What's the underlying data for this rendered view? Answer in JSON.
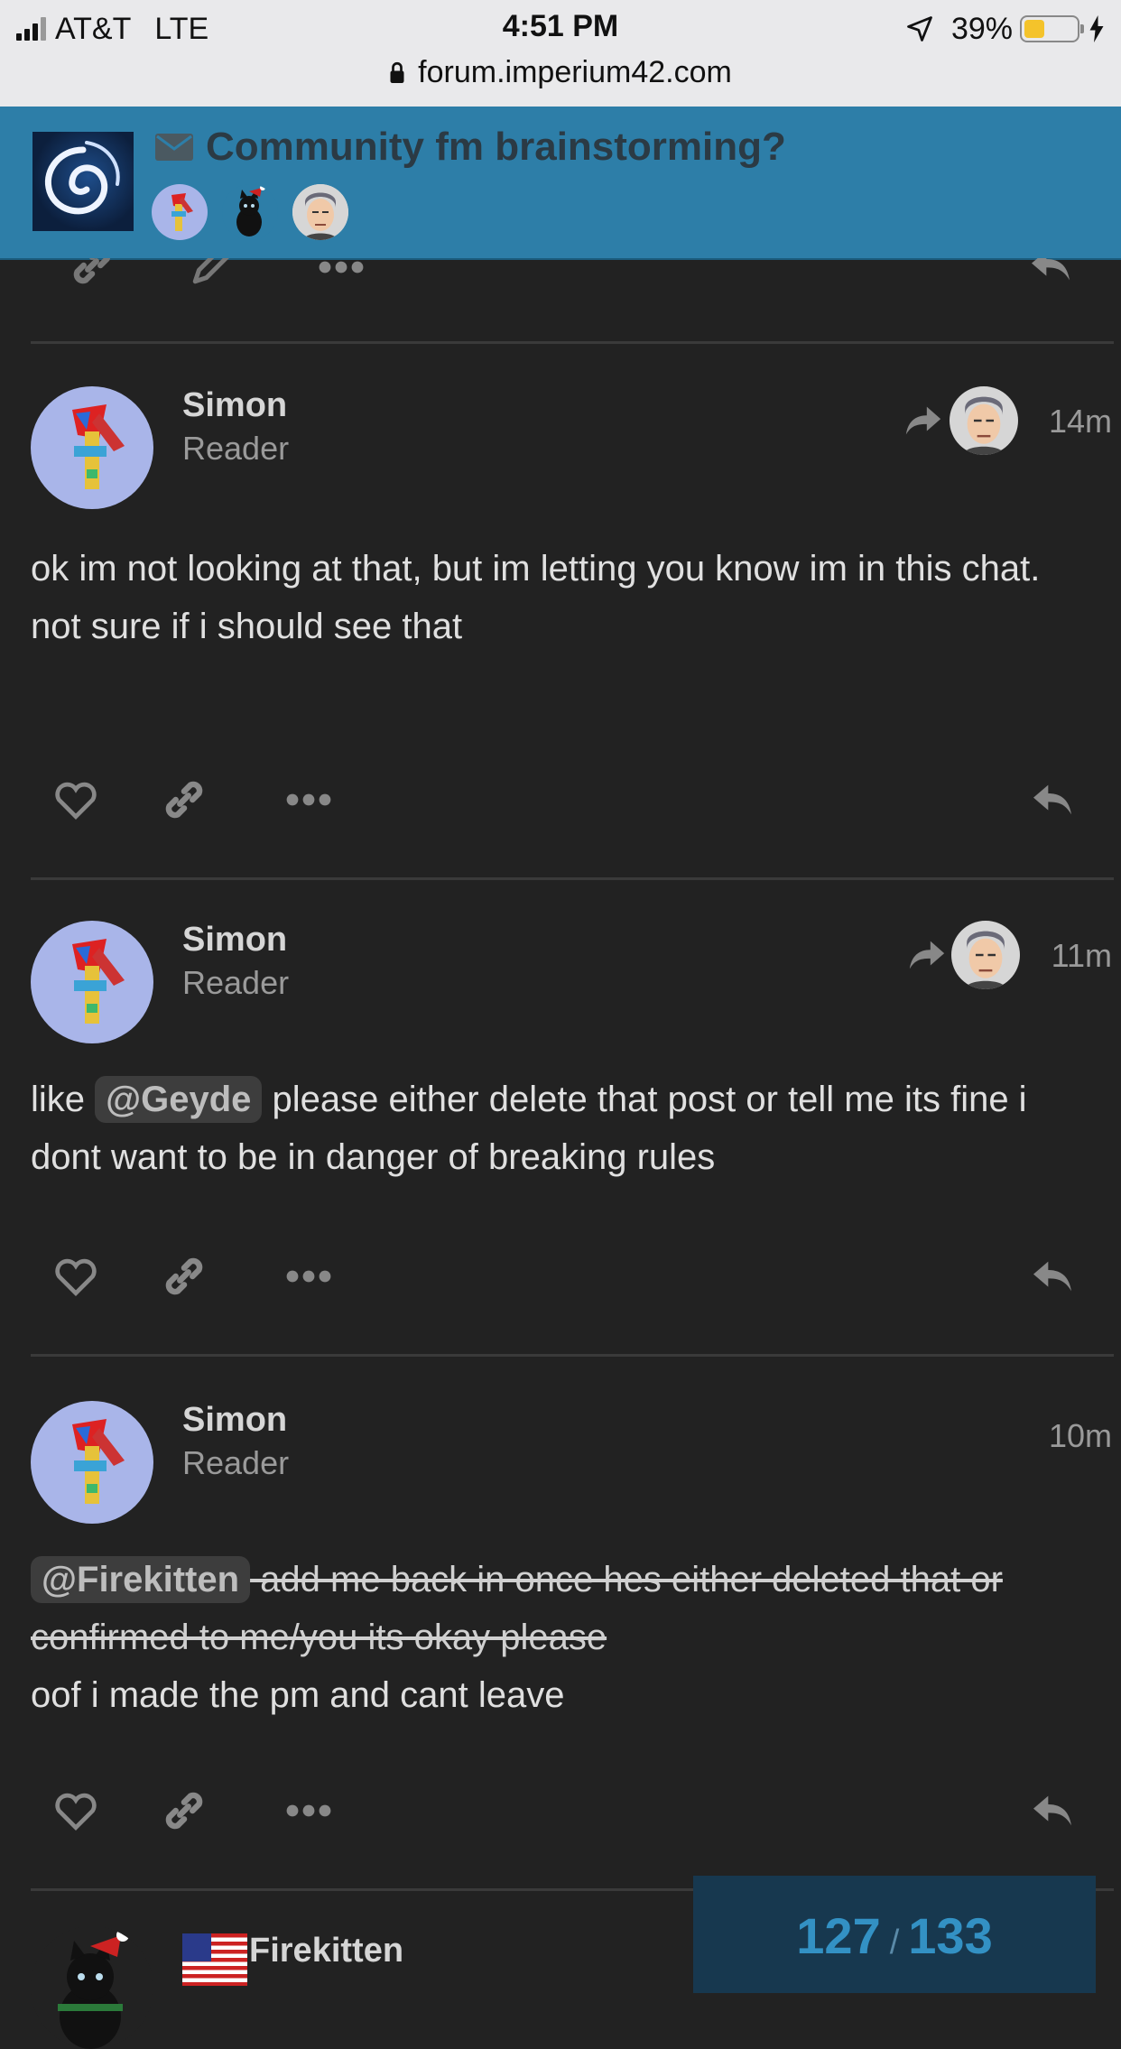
{
  "status_bar": {
    "carrier": "AT&T",
    "network": "LTE",
    "time": "4:51 PM",
    "battery": "39%",
    "battery_level": 0.39,
    "url": "forum.imperium42.com"
  },
  "header": {
    "topic_title": "Community fm brainstorming?",
    "participants": [
      "Simon",
      "Firekitten",
      "Geyde"
    ]
  },
  "posts": [
    {
      "username": "Simon",
      "user_title": "Reader",
      "time": "14m",
      "lines": [
        "ok im not looking at that, but im letting you know im in this chat.",
        "not sure if i should see that"
      ]
    },
    {
      "username": "Simon",
      "user_title": "Reader",
      "time": "11m",
      "before_mention": "like ",
      "mention": "@Geyde",
      "after_mention": " please either delete that post or tell me its fine i dont want to be in danger of breaking rules"
    },
    {
      "username": "Simon",
      "user_title": "Reader",
      "time": "10m",
      "mention": "@Firekitten",
      "struck_text": " add me back in once hes either deleted that or confirmed to me/you its okay please",
      "line2": "oof i made the pm and cant leave"
    }
  ],
  "next_post": {
    "username": "Firekitten"
  },
  "progress": {
    "current": "127",
    "separator": "/",
    "total": "133"
  },
  "colors": {
    "header": "#2d7ea8",
    "background": "#222222",
    "progress_text": "#3391c4"
  }
}
